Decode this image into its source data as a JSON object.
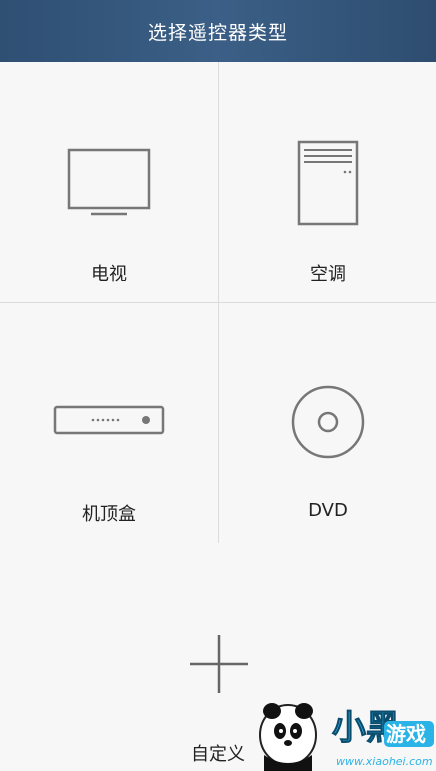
{
  "header": {
    "title": "选择遥控器类型"
  },
  "devices": [
    {
      "label": "电视",
      "icon": "tv-icon"
    },
    {
      "label": "空调",
      "icon": "air-conditioner-icon"
    },
    {
      "label": "机顶盒",
      "icon": "set-top-box-icon"
    },
    {
      "label": "DVD",
      "icon": "dvd-icon"
    }
  ],
  "custom": {
    "label": "自定义",
    "icon": "plus-icon"
  },
  "watermark": {
    "brand": "小黑游戏",
    "url": "www.xiaohei.com"
  },
  "colors": {
    "header_bg": "#34557a",
    "icon_stroke": "#777777",
    "divider": "#dcdcdc",
    "watermark_cyan": "#2ab3e6"
  }
}
